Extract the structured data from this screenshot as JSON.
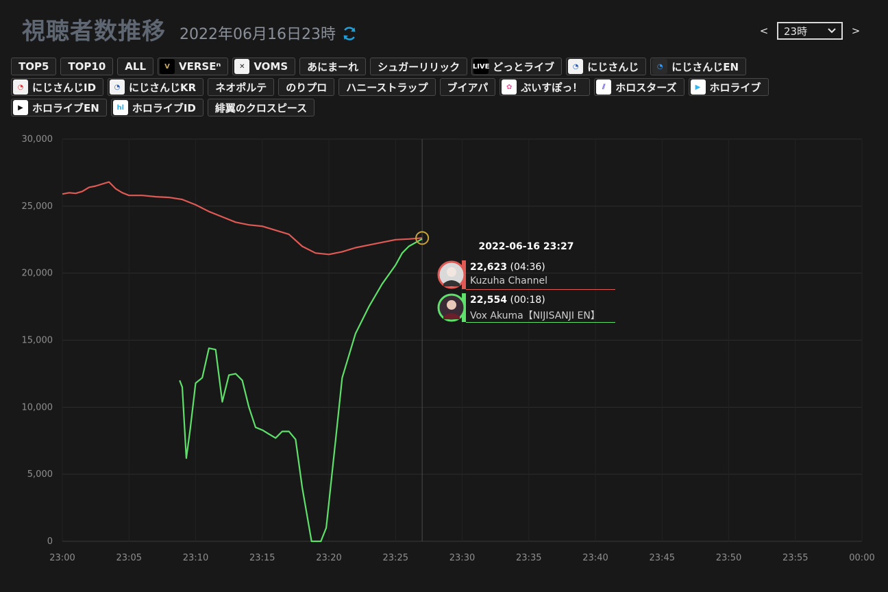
{
  "header": {
    "title": "視聴者数推移",
    "datetime": "2022年06月16日23時",
    "hour_prev": "<",
    "hour_next": ">",
    "hour_selected": "23時"
  },
  "accent_color": "#1f9ed8",
  "filters": [
    [
      {
        "label": "TOP5",
        "logo": ""
      },
      {
        "label": "TOP10",
        "logo": ""
      },
      {
        "label": "ALL",
        "logo": ""
      },
      {
        "label": "VERSEⁿ",
        "logo": "verse-logo"
      },
      {
        "label": "VOMS",
        "logo": "voms-logo"
      },
      {
        "label": "あにまーれ",
        "logo": ""
      },
      {
        "label": "シュガーリリック",
        "logo": ""
      },
      {
        "label": "どっとライブ",
        "logo": "dotlive-logo"
      },
      {
        "label": "にじさんじ",
        "logo": "nijisanji-logo"
      },
      {
        "label": "にじさんじEN",
        "logo": "nijisanji-en-logo"
      }
    ],
    [
      {
        "label": "にじさんじID",
        "logo": "nijisanji-id-logo"
      },
      {
        "label": "にじさんじKR",
        "logo": "nijisanji-kr-logo"
      },
      {
        "label": "ネオポルテ",
        "logo": ""
      },
      {
        "label": "のりプロ",
        "logo": ""
      },
      {
        "label": "ハニーストラップ",
        "logo": ""
      },
      {
        "label": "ブイアパ",
        "logo": ""
      },
      {
        "label": "ぶいすぽっ！",
        "logo": "vspo-logo"
      },
      {
        "label": "ホロスターズ",
        "logo": "holostars-logo"
      },
      {
        "label": "ホロライブ",
        "logo": "hololive-logo"
      }
    ],
    [
      {
        "label": "ホロライブEN",
        "logo": "hololive-en-logo"
      },
      {
        "label": "ホロライブID",
        "logo": "hololive-id-logo"
      },
      {
        "label": "緋翼のクロスピース",
        "logo": ""
      }
    ]
  ],
  "chart_data": {
    "type": "line",
    "title": "",
    "xlabel": "",
    "ylabel": "",
    "x_tick_labels": [
      "23:00",
      "23:05",
      "23:10",
      "23:15",
      "23:20",
      "23:25",
      "23:30",
      "23:35",
      "23:40",
      "23:45",
      "23:50",
      "23:55",
      "00:00"
    ],
    "y_tick_labels": [
      "0",
      "5,000",
      "10,000",
      "15,000",
      "20,000",
      "25,000",
      "30,000"
    ],
    "xlim_minutes": [
      0,
      60
    ],
    "ylim": [
      0,
      30000
    ],
    "grid": true,
    "series": [
      {
        "name": "Kuzuha Channel",
        "color": "#e05a55",
        "points": [
          [
            0,
            25900
          ],
          [
            0.5,
            26000
          ],
          [
            1,
            25950
          ],
          [
            1.5,
            26100
          ],
          [
            2,
            26400
          ],
          [
            2.5,
            26500
          ],
          [
            3,
            26650
          ],
          [
            3.5,
            26800
          ],
          [
            4,
            26300
          ],
          [
            4.5,
            26000
          ],
          [
            5,
            25800
          ],
          [
            6,
            25800
          ],
          [
            7,
            25700
          ],
          [
            8,
            25650
          ],
          [
            9,
            25500
          ],
          [
            10,
            25100
          ],
          [
            11,
            24600
          ],
          [
            12,
            24200
          ],
          [
            13,
            23800
          ],
          [
            14,
            23600
          ],
          [
            15,
            23500
          ],
          [
            16,
            23200
          ],
          [
            17,
            22900
          ],
          [
            18,
            22000
          ],
          [
            19,
            21500
          ],
          [
            20,
            21400
          ],
          [
            21,
            21600
          ],
          [
            22,
            21900
          ],
          [
            23,
            22100
          ],
          [
            24,
            22300
          ],
          [
            25,
            22500
          ],
          [
            26,
            22550
          ],
          [
            27,
            22623
          ]
        ]
      },
      {
        "name": "Vox Akuma【NIJISANJI EN】",
        "color": "#5ee06a",
        "points": [
          [
            8.8,
            12000
          ],
          [
            9,
            11500
          ],
          [
            9.3,
            6200
          ],
          [
            9.6,
            8400
          ],
          [
            10,
            11800
          ],
          [
            10.5,
            12200
          ],
          [
            11,
            14400
          ],
          [
            11.5,
            14300
          ],
          [
            12,
            10400
          ],
          [
            12.5,
            12400
          ],
          [
            13,
            12500
          ],
          [
            13.5,
            12000
          ],
          [
            14,
            10000
          ],
          [
            14.5,
            8500
          ],
          [
            15,
            8300
          ],
          [
            15.5,
            8000
          ],
          [
            16,
            7700
          ],
          [
            16.5,
            8200
          ],
          [
            17,
            8200
          ],
          [
            17.5,
            7600
          ],
          [
            18,
            4000
          ],
          [
            18.7,
            0
          ],
          [
            19.4,
            0
          ],
          [
            19.8,
            1000
          ],
          [
            20.5,
            7500
          ],
          [
            21,
            12200
          ],
          [
            22,
            15500
          ],
          [
            23,
            17500
          ],
          [
            24,
            19200
          ],
          [
            25,
            20600
          ],
          [
            25.5,
            21500
          ],
          [
            26,
            22000
          ],
          [
            27,
            22554
          ]
        ]
      }
    ],
    "hover": {
      "time": "2022-06-16 23:27",
      "x_minute": 27,
      "entries": [
        {
          "value": "22,623",
          "duration": "(04:36)",
          "name": "Kuzuha Channel",
          "color": "#e05a55"
        },
        {
          "value": "22,554",
          "duration": "(00:18)",
          "name": "Vox Akuma【NIJISANJI EN】",
          "color": "#5ee06a"
        }
      ]
    }
  }
}
